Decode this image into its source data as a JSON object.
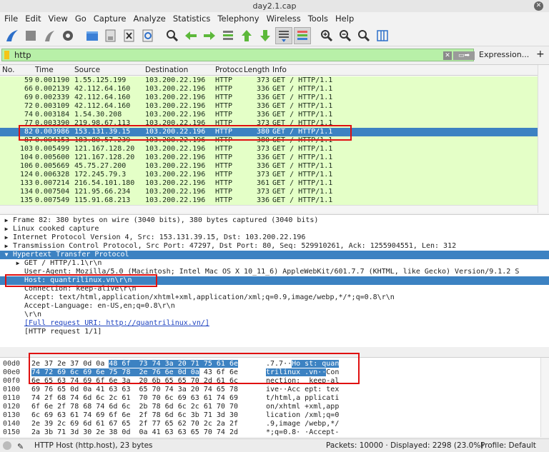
{
  "window": {
    "title": "day2.1.cap",
    "close_glyph": "✕"
  },
  "menu": [
    "File",
    "Edit",
    "View",
    "Go",
    "Capture",
    "Analyze",
    "Statistics",
    "Telephony",
    "Wireless",
    "Tools",
    "Help"
  ],
  "filter": {
    "value": "http",
    "expression_label": "Expression...",
    "add_label": "+",
    "clear_glyph": "✕",
    "apply_glyph": "▭➡"
  },
  "packet_list": {
    "columns": [
      "No.",
      "Time",
      "Source",
      "Destination",
      "Protocol",
      "Length",
      "Info"
    ],
    "rows": [
      {
        "no": "59",
        "time": "0.001190",
        "src": "1.55.125.199",
        "dst": "103.200.22.196",
        "proto": "HTTP",
        "len": "373",
        "info": "GET / HTTP/1.1"
      },
      {
        "no": "66",
        "time": "0.002139",
        "src": "42.112.64.160",
        "dst": "103.200.22.196",
        "proto": "HTTP",
        "len": "336",
        "info": "GET / HTTP/1.1"
      },
      {
        "no": "69",
        "time": "0.002339",
        "src": "42.112.64.160",
        "dst": "103.200.22.196",
        "proto": "HTTP",
        "len": "336",
        "info": "GET / HTTP/1.1"
      },
      {
        "no": "72",
        "time": "0.003109",
        "src": "42.112.64.160",
        "dst": "103.200.22.196",
        "proto": "HTTP",
        "len": "336",
        "info": "GET / HTTP/1.1"
      },
      {
        "no": "74",
        "time": "0.003184",
        "src": "1.54.30.208",
        "dst": "103.200.22.196",
        "proto": "HTTP",
        "len": "336",
        "info": "GET / HTTP/1.1"
      },
      {
        "no": "77",
        "time": "0.003390",
        "src": "219.98.67.113",
        "dst": "103.200.22.196",
        "proto": "HTTP",
        "len": "373",
        "info": "GET / HTTP/1.1"
      },
      {
        "no": "82",
        "time": "0.003986",
        "src": "153.131.39.15",
        "dst": "103.200.22.196",
        "proto": "HTTP",
        "len": "380",
        "info": "GET / HTTP/1.1"
      },
      {
        "no": "87",
        "time": "0.004153",
        "src": "183.80.57.239",
        "dst": "103.200.22.196",
        "proto": "HTTP",
        "len": "380",
        "info": "GET / HTTP/1.1"
      },
      {
        "no": "103",
        "time": "0.005499",
        "src": "121.167.128.20",
        "dst": "103.200.22.196",
        "proto": "HTTP",
        "len": "373",
        "info": "GET / HTTP/1.1"
      },
      {
        "no": "104",
        "time": "0.005600",
        "src": "121.167.128.20",
        "dst": "103.200.22.196",
        "proto": "HTTP",
        "len": "336",
        "info": "GET / HTTP/1.1"
      },
      {
        "no": "106",
        "time": "0.005669",
        "src": "45.75.27.200",
        "dst": "103.200.22.196",
        "proto": "HTTP",
        "len": "336",
        "info": "GET / HTTP/1.1"
      },
      {
        "no": "124",
        "time": "0.006328",
        "src": "172.245.79.3",
        "dst": "103.200.22.196",
        "proto": "HTTP",
        "len": "373",
        "info": "GET / HTTP/1.1"
      },
      {
        "no": "133",
        "time": "0.007214",
        "src": "216.54.101.180",
        "dst": "103.200.22.196",
        "proto": "HTTP",
        "len": "361",
        "info": "GET / HTTP/1.1"
      },
      {
        "no": "134",
        "time": "0.007504",
        "src": "121.95.66.234",
        "dst": "103.200.22.196",
        "proto": "HTTP",
        "len": "373",
        "info": "GET / HTTP/1.1"
      },
      {
        "no": "135",
        "time": "0.007549",
        "src": "115.91.68.213",
        "dst": "103.200.22.196",
        "proto": "HTTP",
        "len": "336",
        "info": "GET / HTTP/1.1"
      }
    ],
    "selected_no": "82"
  },
  "details": [
    {
      "arrow": "▶",
      "text": "Frame 82: 380 bytes on wire (3040 bits), 380 bytes captured (3040 bits)"
    },
    {
      "arrow": "▶",
      "text": "Linux cooked capture"
    },
    {
      "arrow": "▶",
      "text": "Internet Protocol Version 4, Src: 153.131.39.15, Dst: 103.200.22.196"
    },
    {
      "arrow": "▶",
      "text": "Transmission Control Protocol, Src Port: 47297, Dst Port: 80, Seq: 529910261, Ack: 1255904551, Len: 312"
    },
    {
      "arrow": "▼",
      "text": "Hypertext Transfer Protocol"
    },
    {
      "arrow": "▶",
      "text": "GET / HTTP/1.1\\r\\n"
    },
    {
      "arrow": "",
      "text": "User-Agent: Mozilla/5.0 (Macintosh; Intel Mac OS X 10_11_6) AppleWebKit/601.7.7 (KHTML, like Gecko) Version/9.1.2 S"
    },
    {
      "arrow": "",
      "text": "Host: quantrilinux.vn\\r\\n"
    },
    {
      "arrow": "",
      "text": "Connection: keep-alive\\r\\n"
    },
    {
      "arrow": "",
      "text": "Accept: text/html,application/xhtml+xml,application/xml;q=0.9,image/webp,*/*;q=0.8\\r\\n"
    },
    {
      "arrow": "",
      "text": "Accept-Language: en-US,en;q=0.8\\r\\n"
    },
    {
      "arrow": "",
      "text": "\\r\\n"
    },
    {
      "arrow": "",
      "text": "[Full request URI: http://quantrilinux.vn/]"
    },
    {
      "arrow": "",
      "text": "[HTTP request 1/1]"
    }
  ],
  "bytes": [
    {
      "off": "00d0",
      "hex_a": "2e 37 2e 37 0d 0a ",
      "hex_b": "48 6f  73 74 3a 20 71 75 61 6e",
      "hex_c": "",
      "asc_a": ".7.7··",
      "asc_b": "Ho st: quan",
      "asc_c": ""
    },
    {
      "off": "00e0",
      "hex_a": "",
      "hex_b": "74 72 69 6c 69 6e 75 78  2e 76 6e 0d 0a",
      "hex_c": " 43 6f 6e",
      "asc_a": "",
      "asc_b": "trilinux .vn··",
      "asc_c": "Con"
    },
    {
      "off": "00f0",
      "hex_a": "6e 65 63 74 69 6f 6e 3a  20 6b 65 65 70 2d 61 6c",
      "hex_b": "",
      "hex_c": "",
      "asc_a": "nection:  keep-al",
      "asc_b": "",
      "asc_c": ""
    },
    {
      "off": "0100",
      "hex_a": "69 76 65 0d 0a 41 63 63  65 70 74 3a 20 74 65 78",
      "hex_b": "",
      "hex_c": "",
      "asc_a": "ive··Acc ept: tex",
      "asc_b": "",
      "asc_c": ""
    },
    {
      "off": "0110",
      "hex_a": "74 2f 68 74 6d 6c 2c 61  70 70 6c 69 63 61 74 69",
      "hex_b": "",
      "hex_c": "",
      "asc_a": "t/html,a pplicati",
      "asc_b": "",
      "asc_c": ""
    },
    {
      "off": "0120",
      "hex_a": "6f 6e 2f 78 68 74 6d 6c  2b 78 6d 6c 2c 61 70 70",
      "hex_b": "",
      "hex_c": "",
      "asc_a": "on/xhtml +xml,app",
      "asc_b": "",
      "asc_c": ""
    },
    {
      "off": "0130",
      "hex_a": "6c 69 63 61 74 69 6f 6e  2f 78 6d 6c 3b 71 3d 30",
      "hex_b": "",
      "hex_c": "",
      "asc_a": "lication /xml;q=0",
      "asc_b": "",
      "asc_c": ""
    },
    {
      "off": "0140",
      "hex_a": "2e 39 2c 69 6d 61 67 65  2f 77 65 62 70 2c 2a 2f",
      "hex_b": "",
      "hex_c": "",
      "asc_a": ".9,image /webp,*/",
      "asc_b": "",
      "asc_c": ""
    },
    {
      "off": "0150",
      "hex_a": "2a 3b 71 3d 30 2e 38 0d  0a 41 63 63 65 70 74 2d",
      "hex_b": "",
      "hex_c": "",
      "asc_a": "*;q=0.8· ·Accept-",
      "asc_b": "",
      "asc_c": ""
    }
  ],
  "status": {
    "field": "HTTP Host (http.host), 23 bytes",
    "packets": "Packets: 10000 · Displayed: 2298 (23.0%)",
    "profile": "Profile: Default"
  },
  "colors": {
    "selected": "#3c82c2",
    "http_row": "#e4ffc7",
    "filter_ok": "#b8f0a8",
    "annotation": "#e01010"
  }
}
